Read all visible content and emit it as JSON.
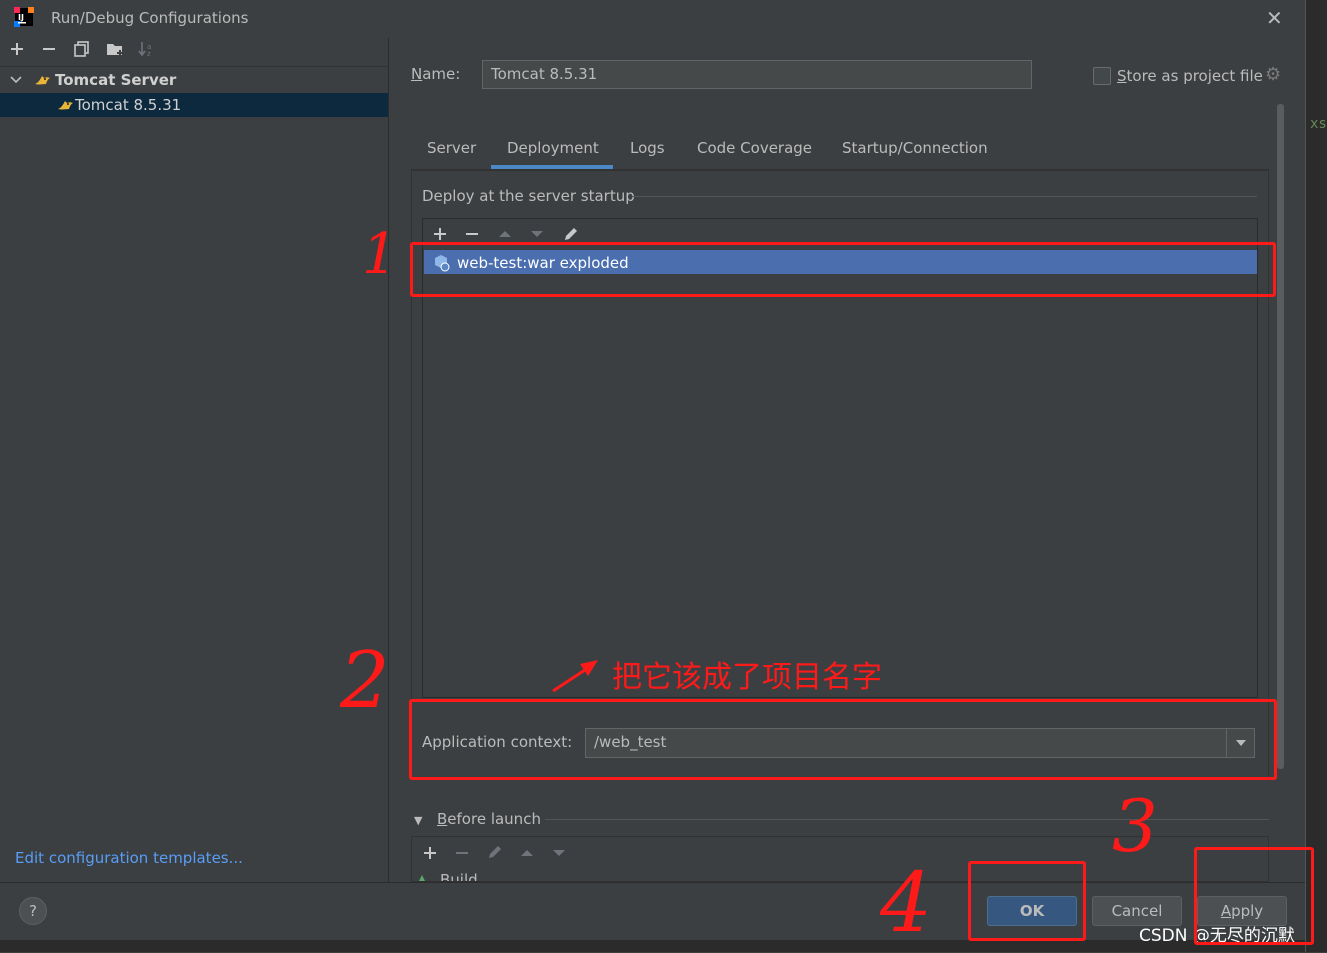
{
  "window": {
    "title": "Run/Debug Configurations",
    "close_glyph": "✕"
  },
  "left_toolbar": {
    "icons": [
      "add-icon",
      "remove-icon",
      "copy-icon",
      "folder-add-icon",
      "sort-icon"
    ]
  },
  "tree": {
    "group_label": "Tomcat Server",
    "item_label": "Tomcat 8.5.31"
  },
  "left_footer": {
    "edit_templates": "Edit configuration templates..."
  },
  "form": {
    "name_label_accel": "N",
    "name_label_rest": "ame:",
    "name_value": "Tomcat 8.5.31",
    "store_label_accel": "S",
    "store_label_rest": "tore as project file"
  },
  "tabs": [
    {
      "label": "Server",
      "selected": false
    },
    {
      "label": "Deployment",
      "selected": true
    },
    {
      "label": "Logs",
      "selected": false
    },
    {
      "label": "Code Coverage",
      "selected": false
    },
    {
      "label": "Startup/Connection",
      "selected": false
    }
  ],
  "deployment": {
    "section_title": "Deploy at the server startup",
    "artifacts": [
      "web-test:war exploded"
    ],
    "context_label": "Application context:",
    "context_value": "/web_test"
  },
  "before_launch": {
    "label_accel": "B",
    "label_rest": "efore launch",
    "items": [
      "Build"
    ]
  },
  "buttons": {
    "help": "?",
    "ok": "OK",
    "cancel": "Cancel",
    "apply_accel": "A",
    "apply_rest": "pply"
  },
  "annotations": {
    "num1": "1",
    "num2": "2",
    "num3": "3",
    "num4": "4",
    "note": "把它该成了项目名字",
    "color": "#ff1a1a"
  },
  "watermark": "CSDN @无尽的沉默",
  "edge_text": "xs",
  "colors": {
    "background": "#3c3f41",
    "selection": "#4b6eaf",
    "tree_selection": "#0d293e",
    "link": "#589df6",
    "ok_button": "#365880",
    "tab_underline": "#4a88c7"
  }
}
